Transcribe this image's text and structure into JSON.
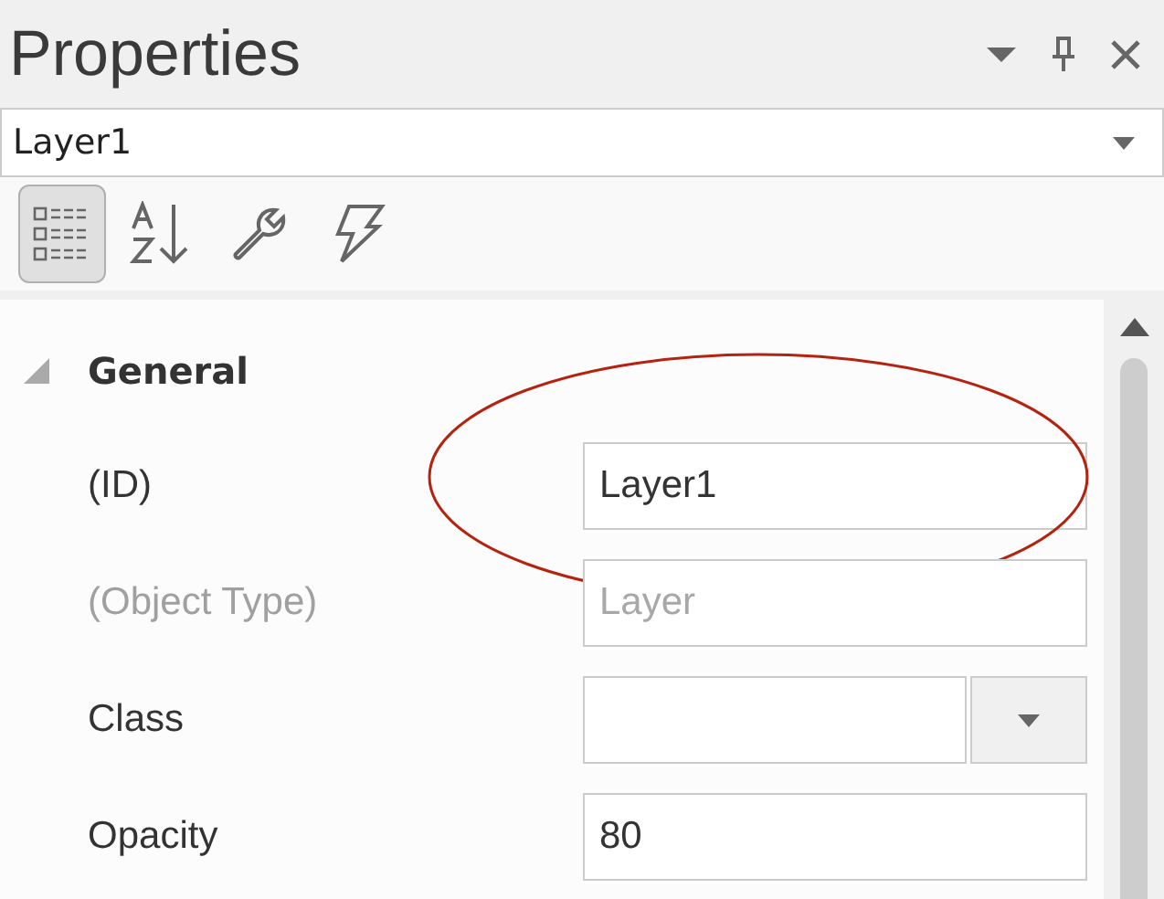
{
  "panel": {
    "title": "Properties"
  },
  "object_selector": {
    "value": "Layer1"
  },
  "toolbar": [
    {
      "kind": "categorized",
      "selected": true
    },
    {
      "kind": "alphabetical",
      "selected": false
    },
    {
      "kind": "properties",
      "selected": false
    },
    {
      "kind": "events",
      "selected": false
    }
  ],
  "category": {
    "label": "General",
    "expanded": true
  },
  "properties": [
    {
      "name": "(ID)",
      "kind": "text",
      "value": "Layer1",
      "disabled": false,
      "highlighted": true
    },
    {
      "name": "(Object Type)",
      "kind": "text",
      "value": "Layer",
      "disabled": true,
      "highlighted": false
    },
    {
      "name": "Class",
      "kind": "combo",
      "disabled": false,
      "highlighted": false
    },
    {
      "name": "Opacity",
      "kind": "text",
      "value": "80",
      "disabled": false,
      "highlighted": false
    }
  ]
}
